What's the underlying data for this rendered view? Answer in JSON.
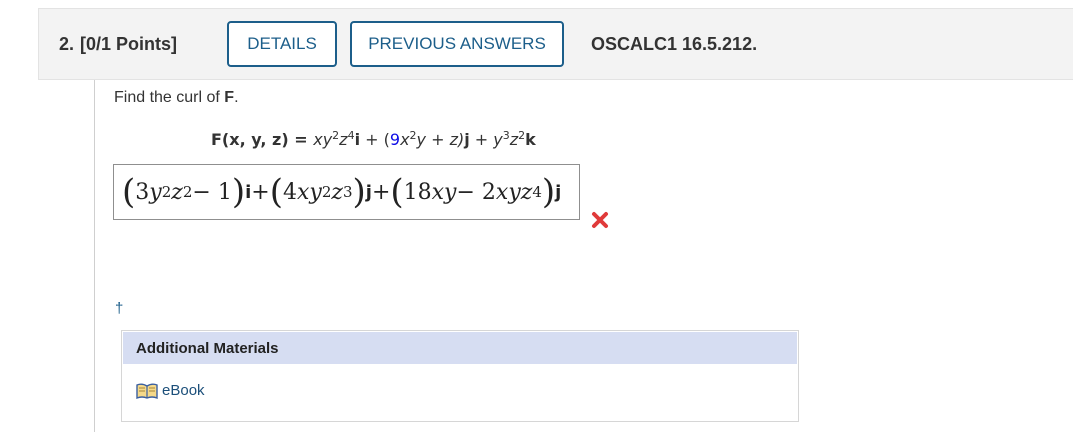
{
  "header": {
    "question_number": "2.",
    "points": "[0/1 Points]",
    "details_label": "DETAILS",
    "previous_answers_label": "PREVIOUS ANSWERS",
    "reference": "OSCALC1 16.5.212."
  },
  "question": {
    "prompt_prefix": "Find the curl of ",
    "prompt_bold": "F",
    "prompt_suffix": ".",
    "formula": {
      "lhs": "F(x, y, z) = ",
      "xy": "xy",
      "exp_2a": "2",
      "z": "z",
      "exp_4": "4",
      "i": "i",
      "plus1": " + (",
      "nine": "9",
      "x": "x",
      "exp_2b": "2",
      "y_plus_z": "y + z)",
      "j": "j",
      "plus2": " + ",
      "y": "y",
      "exp_3": "3",
      "z2": "z",
      "exp_2c": "2",
      "k": "k"
    }
  },
  "answer": {
    "status": "incorrect",
    "status_icon": "x-mark-icon",
    "status_color": "#e03a3a",
    "term1_coef": "3",
    "term1_var": "y",
    "term1_exp1": "2",
    "term1_var2": "z",
    "term1_exp2": "2",
    "term1_tail": " − 1",
    "term1_unit": "i",
    "plus_a": " + ",
    "term2_coef": "4",
    "term2_var": "xy",
    "term2_exp1": "2",
    "term2_var2": "z",
    "term2_exp2": "3",
    "term2_unit": "j",
    "plus_b": " + ",
    "term3_coef": "18",
    "term3_var": "xy",
    "term3_mid": " − 2",
    "term3_var2": "xyz",
    "term3_exp": "4",
    "term3_unit": "j"
  },
  "footnote_marker": "†",
  "additional_materials": {
    "title": "Additional Materials",
    "ebook_label": "eBook",
    "ebook_icon": "open-book-icon"
  }
}
